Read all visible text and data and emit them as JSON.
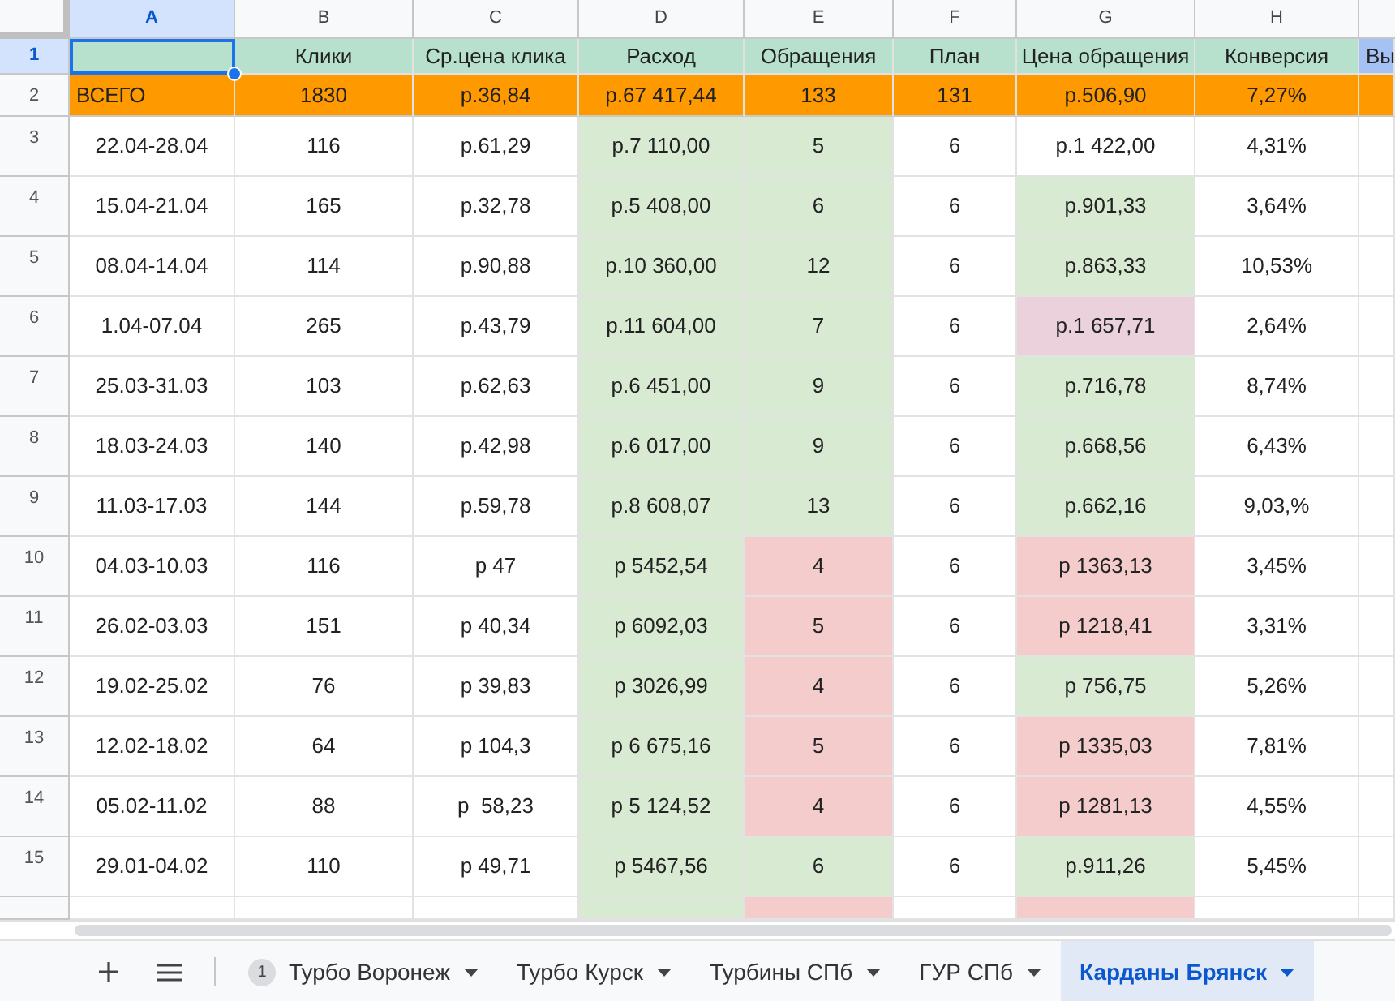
{
  "columns": [
    {
      "letter": "A",
      "selected": true
    },
    {
      "letter": "B",
      "selected": false
    },
    {
      "letter": "C",
      "selected": false
    },
    {
      "letter": "D",
      "selected": false
    },
    {
      "letter": "E",
      "selected": false
    },
    {
      "letter": "F",
      "selected": false
    },
    {
      "letter": "G",
      "selected": false
    },
    {
      "letter": "H",
      "selected": false
    }
  ],
  "rows": [
    {
      "number": "1",
      "kind": "header",
      "selected": true,
      "cells": [
        {
          "color": "#b7e1cd",
          "selected": true
        },
        {
          "text": "Клики",
          "color": "#b7e1cd"
        },
        {
          "text": "Ср.цена клика",
          "color": "#b7e1cd"
        },
        {
          "text": "Расход",
          "color": "#b7e1cd"
        },
        {
          "text": "Обращения",
          "color": "#b7e1cd"
        },
        {
          "text": "План",
          "color": "#b7e1cd"
        },
        {
          "text": "Цена обращения",
          "color": "#b7e1cd"
        },
        {
          "text": "Конверсия",
          "color": "#b7e1cd"
        },
        {
          "text": "Вы",
          "color": "#a4c2f4"
        }
      ]
    },
    {
      "number": "2",
      "kind": "total",
      "selected": false,
      "cells": [
        {
          "text": "ВСЕГО",
          "color": "#ff9900"
        },
        {
          "text": "1830",
          "color": "#ff9900"
        },
        {
          "text": "р.36,84",
          "color": "#ff9900"
        },
        {
          "text": "р.67 417,44",
          "color": "#ff9900"
        },
        {
          "text": "133",
          "color": "#ff9900"
        },
        {
          "text": "131",
          "color": "#ff9900"
        },
        {
          "text": "р.506,90",
          "color": "#ff9900"
        },
        {
          "text": "7,27%",
          "color": "#ff9900"
        },
        {
          "color": "#ff9900"
        }
      ]
    },
    {
      "number": "3",
      "kind": "data",
      "selected": false,
      "cells": [
        {
          "text": "22.04-28.04"
        },
        {
          "text": "116"
        },
        {
          "text": "р.61,29"
        },
        {
          "text": "р.7 110,00",
          "color": "#d9ead3"
        },
        {
          "text": "5",
          "color": "#d9ead3"
        },
        {
          "text": "6"
        },
        {
          "text": "р.1 422,00"
        },
        {
          "text": "4,31%"
        },
        {}
      ]
    },
    {
      "number": "4",
      "kind": "data",
      "selected": false,
      "cells": [
        {
          "text": "15.04-21.04"
        },
        {
          "text": "165"
        },
        {
          "text": "р.32,78"
        },
        {
          "text": "р.5 408,00",
          "color": "#d9ead3"
        },
        {
          "text": "6",
          "color": "#d9ead3"
        },
        {
          "text": "6"
        },
        {
          "text": "р.901,33",
          "color": "#d9ead3"
        },
        {
          "text": "3,64%"
        },
        {}
      ]
    },
    {
      "number": "5",
      "kind": "data",
      "selected": false,
      "cells": [
        {
          "text": "08.04-14.04"
        },
        {
          "text": "114"
        },
        {
          "text": "р.90,88"
        },
        {
          "text": "р.10 360,00",
          "color": "#d9ead3"
        },
        {
          "text": "12",
          "color": "#d9ead3"
        },
        {
          "text": "6"
        },
        {
          "text": "р.863,33",
          "color": "#d9ead3"
        },
        {
          "text": "10,53%"
        },
        {}
      ]
    },
    {
      "number": "6",
      "kind": "data",
      "selected": false,
      "cells": [
        {
          "text": "1.04-07.04"
        },
        {
          "text": "265"
        },
        {
          "text": "р.43,79"
        },
        {
          "text": "р.11 604,00",
          "color": "#d9ead3"
        },
        {
          "text": "7",
          "color": "#d9ead3"
        },
        {
          "text": "6"
        },
        {
          "text": "р.1 657,71",
          "color": "#ead1dc"
        },
        {
          "text": "2,64%"
        },
        {}
      ]
    },
    {
      "number": "7",
      "kind": "data",
      "selected": false,
      "cells": [
        {
          "text": "25.03-31.03"
        },
        {
          "text": "103"
        },
        {
          "text": "р.62,63"
        },
        {
          "text": "р.6 451,00",
          "color": "#d9ead3"
        },
        {
          "text": "9",
          "color": "#d9ead3"
        },
        {
          "text": "6"
        },
        {
          "text": "р.716,78",
          "color": "#d9ead3"
        },
        {
          "text": "8,74%"
        },
        {}
      ]
    },
    {
      "number": "8",
      "kind": "data",
      "selected": false,
      "cells": [
        {
          "text": "18.03-24.03"
        },
        {
          "text": "140"
        },
        {
          "text": "р.42,98"
        },
        {
          "text": "р.6 017,00",
          "color": "#d9ead3"
        },
        {
          "text": "9",
          "color": "#d9ead3"
        },
        {
          "text": "6"
        },
        {
          "text": "р.668,56",
          "color": "#d9ead3"
        },
        {
          "text": "6,43%"
        },
        {}
      ]
    },
    {
      "number": "9",
      "kind": "data",
      "selected": false,
      "cells": [
        {
          "text": "11.03-17.03"
        },
        {
          "text": "144"
        },
        {
          "text": "р.59,78"
        },
        {
          "text": "р.8 608,07",
          "color": "#d9ead3"
        },
        {
          "text": "13",
          "color": "#d9ead3"
        },
        {
          "text": "6"
        },
        {
          "text": "р.662,16",
          "color": "#d9ead3"
        },
        {
          "text": "9,03,%"
        },
        {}
      ]
    },
    {
      "number": "10",
      "kind": "data",
      "selected": false,
      "cells": [
        {
          "text": "04.03-10.03"
        },
        {
          "text": "116"
        },
        {
          "text": "р 47"
        },
        {
          "text": "р 5452,54",
          "color": "#d9ead3"
        },
        {
          "text": "4",
          "color": "#f4cccc"
        },
        {
          "text": "6"
        },
        {
          "text": "р 1363,13",
          "color": "#f4cccc"
        },
        {
          "text": "3,45%"
        },
        {}
      ]
    },
    {
      "number": "11",
      "kind": "data",
      "selected": false,
      "cells": [
        {
          "text": "26.02-03.03"
        },
        {
          "text": "151"
        },
        {
          "text": "р 40,34"
        },
        {
          "text": "р 6092,03",
          "color": "#d9ead3"
        },
        {
          "text": "5",
          "color": "#f4cccc"
        },
        {
          "text": "6"
        },
        {
          "text": "р 1218,41",
          "color": "#f4cccc"
        },
        {
          "text": "3,31%"
        },
        {}
      ]
    },
    {
      "number": "12",
      "kind": "data",
      "selected": false,
      "cells": [
        {
          "text": "19.02-25.02"
        },
        {
          "text": "76"
        },
        {
          "text": "р 39,83"
        },
        {
          "text": "р 3026,99",
          "color": "#d9ead3"
        },
        {
          "text": "4",
          "color": "#f4cccc"
        },
        {
          "text": "6"
        },
        {
          "text": "р 756,75",
          "color": "#d9ead3"
        },
        {
          "text": "5,26%"
        },
        {}
      ]
    },
    {
      "number": "13",
      "kind": "data",
      "selected": false,
      "cells": [
        {
          "text": "12.02-18.02"
        },
        {
          "text": "64"
        },
        {
          "text": "р 104,3"
        },
        {
          "text": "р 6 675,16",
          "color": "#d9ead3"
        },
        {
          "text": "5",
          "color": "#f4cccc"
        },
        {
          "text": "6"
        },
        {
          "text": "р 1335,03",
          "color": "#f4cccc"
        },
        {
          "text": "7,81%"
        },
        {}
      ]
    },
    {
      "number": "14",
      "kind": "data",
      "selected": false,
      "cells": [
        {
          "text": "05.02-11.02"
        },
        {
          "text": "88"
        },
        {
          "text": "р  58,23"
        },
        {
          "text": "р 5 124,52",
          "color": "#d9ead3"
        },
        {
          "text": "4",
          "color": "#f4cccc"
        },
        {
          "text": "6"
        },
        {
          "text": "р 1281,13",
          "color": "#f4cccc"
        },
        {
          "text": "4,55%"
        },
        {}
      ]
    },
    {
      "number": "15",
      "kind": "data",
      "selected": false,
      "cells": [
        {
          "text": "29.01-04.02"
        },
        {
          "text": "110"
        },
        {
          "text": "р 49,71"
        },
        {
          "text": "р 5467,56",
          "color": "#d9ead3"
        },
        {
          "text": "6",
          "color": "#d9ead3"
        },
        {
          "text": "6"
        },
        {
          "text": "р.911,26",
          "color": "#d9ead3"
        },
        {
          "text": "5,45%"
        },
        {}
      ]
    },
    {
      "kind": "partial",
      "selected": false,
      "cells": [
        {},
        {},
        {},
        {
          "color": "#d9ead3"
        },
        {
          "color": "#f4cccc"
        },
        {},
        {
          "color": "#f4cccc"
        },
        {},
        {}
      ]
    }
  ],
  "sheet_tabs": [
    {
      "label": "Турбо Воронеж",
      "badge": "1",
      "selected": false
    },
    {
      "label": "Турбо Курск",
      "selected": false
    },
    {
      "label": "Турбины СПб",
      "selected": false
    },
    {
      "label": "ГУР СПб",
      "selected": false
    },
    {
      "label": "Карданы Брянск",
      "selected": true
    }
  ]
}
